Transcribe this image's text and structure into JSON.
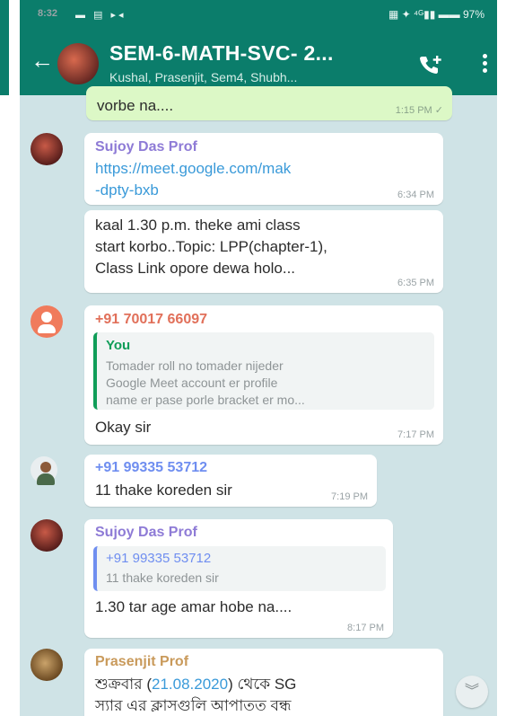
{
  "status_bar": {
    "time": "8:32",
    "indicators": "▬ ▤ ▸◂",
    "right": "▦ ✦ ⁴ᴳ▮▮ ▬▬ 97%"
  },
  "header": {
    "back_icon": "arrow-left",
    "title": "SEM-6-MATH-SVC- 2...",
    "subtitle": "Kushal, Prasenjit, Sem4, Shubh..."
  },
  "colors": {
    "header": "#0b7d6b",
    "chat_bg": "#cfe3e6",
    "outgoing_bubble": "#dcf8c6",
    "sujoy_name": "#8e7bd6",
    "unknown_name": "#e1705a",
    "you_name": "#0f9d58",
    "p9933_name": "#6f8ef0",
    "prasenjit_name": "#c99a5b"
  },
  "messages": [
    {
      "direction": "out",
      "text": "vorbe na....",
      "time": "1:15 PM ✓"
    },
    {
      "sender": "Sujoy Das Prof",
      "link": "https://meet.google.com/mak-dpty-bxb",
      "link_line1": "https://meet.google.com/mak",
      "link_line2": "-dpty-bxb",
      "time": "6:34 PM"
    },
    {
      "text_lines": [
        "kaal 1.30 p.m. theke ami class",
        "start korbo..Topic: LPP(chapter-1),",
        "Class Link opore dewa holo..."
      ],
      "time": "6:35 PM"
    },
    {
      "sender": "+91 70017 66097",
      "quote": {
        "name": "You",
        "lines": [
          "Tomader roll no tomader nijeder",
          "Google Meet account er profile",
          "name er pase porle bracket er mo..."
        ]
      },
      "text": "Okay sir",
      "time": "7:17 PM"
    },
    {
      "sender": "+91 99335 53712",
      "text": "11 thake koreden sir",
      "time": "7:19 PM"
    },
    {
      "sender": "Sujoy Das Prof",
      "quote": {
        "name": "+91 99335 53712",
        "lines": [
          "11 thake koreden sir"
        ]
      },
      "text": "1.30 tar age amar hobe na....",
      "time": "8:17 PM"
    },
    {
      "sender": "Prasenjit Prof",
      "text_parts": [
        "শুক্রবার (",
        "21.08.2020",
        ") থেকে SG"
      ],
      "text_line2": "স্যার এর ক্লাসগুলি আপাতত বন্ধ"
    }
  ]
}
